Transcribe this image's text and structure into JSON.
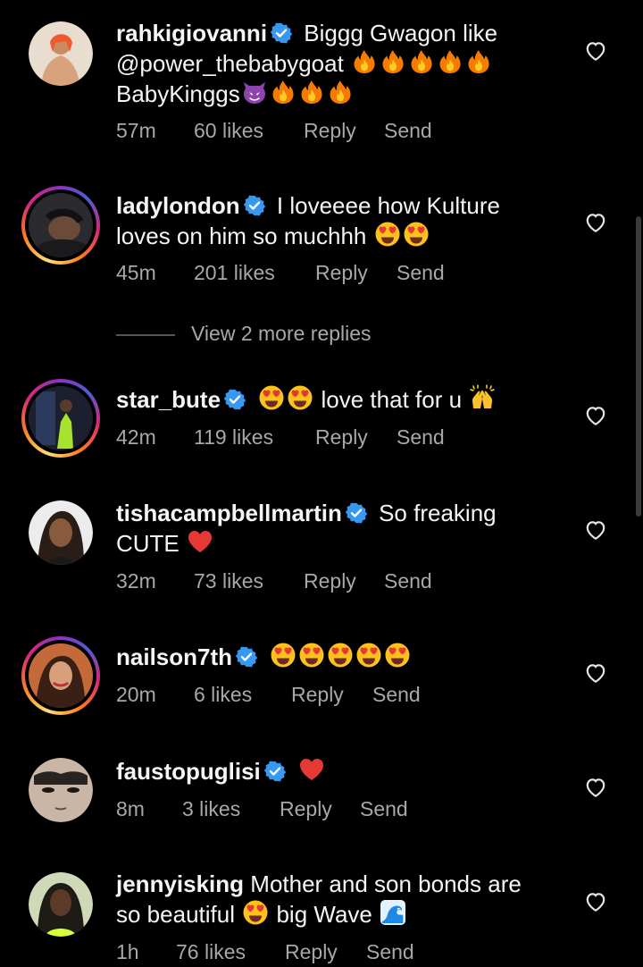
{
  "comments": [
    {
      "username": "rahkigiovanni",
      "text_a": "Biggg Gwagon like",
      "mention": "@power_thebabygoat",
      "text_b": "BabyKinggs",
      "time": "57m",
      "likes": "60 likes",
      "reply": "Reply",
      "send": "Send"
    },
    {
      "username": "ladylondon",
      "text_a": "I loveeee how Kulture",
      "text_b": "loves on him so muchhh",
      "time": "45m",
      "likes": "201 likes",
      "reply": "Reply",
      "send": "Send"
    },
    {
      "username": "star_bute",
      "text_a": "love that for u",
      "time": "42m",
      "likes": "119 likes",
      "reply": "Reply",
      "send": "Send"
    },
    {
      "username": "tishacampbellmartin",
      "text_a": "So freaking",
      "text_b": "CUTE",
      "time": "32m",
      "likes": "73 likes",
      "reply": "Reply",
      "send": "Send"
    },
    {
      "username": "nailson7th",
      "time": "20m",
      "likes": "6 likes",
      "reply": "Reply",
      "send": "Send"
    },
    {
      "username": "faustopuglisi",
      "time": "8m",
      "likes": "3 likes",
      "reply": "Reply",
      "send": "Send"
    },
    {
      "username": "jennyisking",
      "text_a": "Mother and son bonds are",
      "text_b": "so beautiful",
      "text_c": "big Wave",
      "time": "1h",
      "likes": "76 likes",
      "reply": "Reply",
      "send": "Send"
    }
  ],
  "view_replies": "View 2 more replies",
  "colors": {
    "background": "#000000",
    "verified": "#3897f0",
    "meta_text": "#a8a8a8"
  },
  "icons": [
    "verified-badge-icon",
    "heart-outline-icon",
    "fire-emoji",
    "smiling-imp-emoji",
    "heart-eyes-emoji",
    "raised-hands-emoji",
    "red-heart-emoji",
    "water-wave-emoji"
  ]
}
